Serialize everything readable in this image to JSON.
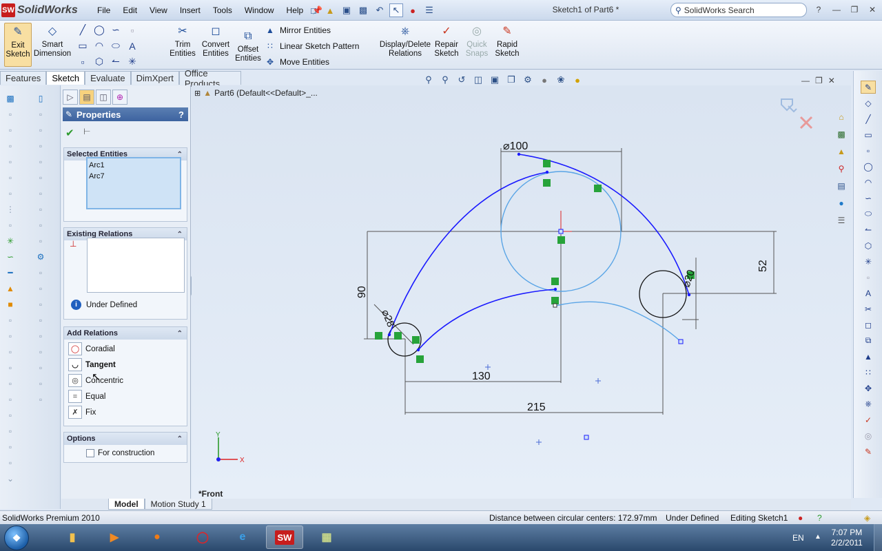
{
  "app": {
    "logo_text": "SolidWorks",
    "menu": [
      "File",
      "Edit",
      "View",
      "Insert",
      "Tools",
      "Window",
      "Help"
    ],
    "doc_title": "Sketch1 of Part6 *",
    "search_placeholder": "SolidWorks Search"
  },
  "commands": {
    "exit_sketch": "Exit\nSketch",
    "smart_dimension": "Smart\nDimension",
    "trim_entities": "Trim\nEntities",
    "convert_entities": "Convert\nEntities",
    "offset_entities": "Offset\nEntities",
    "mirror_entities": "Mirror Entities",
    "linear_sketch_pattern": "Linear Sketch Pattern",
    "move_entities": "Move Entities",
    "display_delete_relations": "Display/Delete\nRelations",
    "repair_sketch": "Repair\nSketch",
    "quick_snaps": "Quick\nSnaps",
    "rapid_sketch": "Rapid\nSketch"
  },
  "tabs": [
    "Features",
    "Sketch",
    "Evaluate",
    "DimXpert",
    "Office Products"
  ],
  "active_tab": "Sketch",
  "tree": {
    "root": "Part6  (Default<<Default>_..."
  },
  "property_manager": {
    "title": "Properties",
    "help": "?",
    "selected_entities": {
      "label": "Selected Entities",
      "items": [
        "Arc1",
        "Arc7"
      ]
    },
    "existing_relations": {
      "label": "Existing Relations",
      "status": "Under Defined"
    },
    "add_relations": {
      "label": "Add Relations",
      "items": [
        "Coradial",
        "Tangent",
        "Concentric",
        "Equal",
        "Fix"
      ]
    },
    "options": {
      "label": "Options",
      "for_construction": "For construction",
      "for_construction_checked": false
    }
  },
  "sketch": {
    "dimensions": [
      "⌀100",
      "52",
      "90",
      "130",
      "215",
      "⌀28",
      "⌀20"
    ],
    "view_label": "*Front",
    "axis_x": "X",
    "axis_y": "Y"
  },
  "bottom_tabs": [
    "Model",
    "Motion Study 1"
  ],
  "active_bottom_tab": "Model",
  "status": {
    "product": "SolidWorks Premium 2010",
    "message": "Distance between circular centers: 172.97mm",
    "state": "Under Defined",
    "editing": "Editing Sketch1"
  },
  "taskbar": {
    "start_icon": "windows-logo-icon",
    "apps": [
      "explorer-folder-icon",
      "media-player-icon",
      "firefox-icon",
      "opera-icon",
      "internet-explorer-icon",
      "solidworks-icon",
      "notes-icon"
    ],
    "active_app": "solidworks-icon",
    "app_labels": {
      "solidworks": "SW"
    },
    "language": "EN",
    "time": "7:07 PM",
    "date": "2/2/2011"
  },
  "colors": {
    "sketch_blue": "#1a1aff",
    "construction_light_blue": "#5aa5e6",
    "relation_green": "#27a33a",
    "selection_blue": "#cfe3f6",
    "titlebar": "#cbd9ec",
    "pm_header": "#4a70a8"
  }
}
